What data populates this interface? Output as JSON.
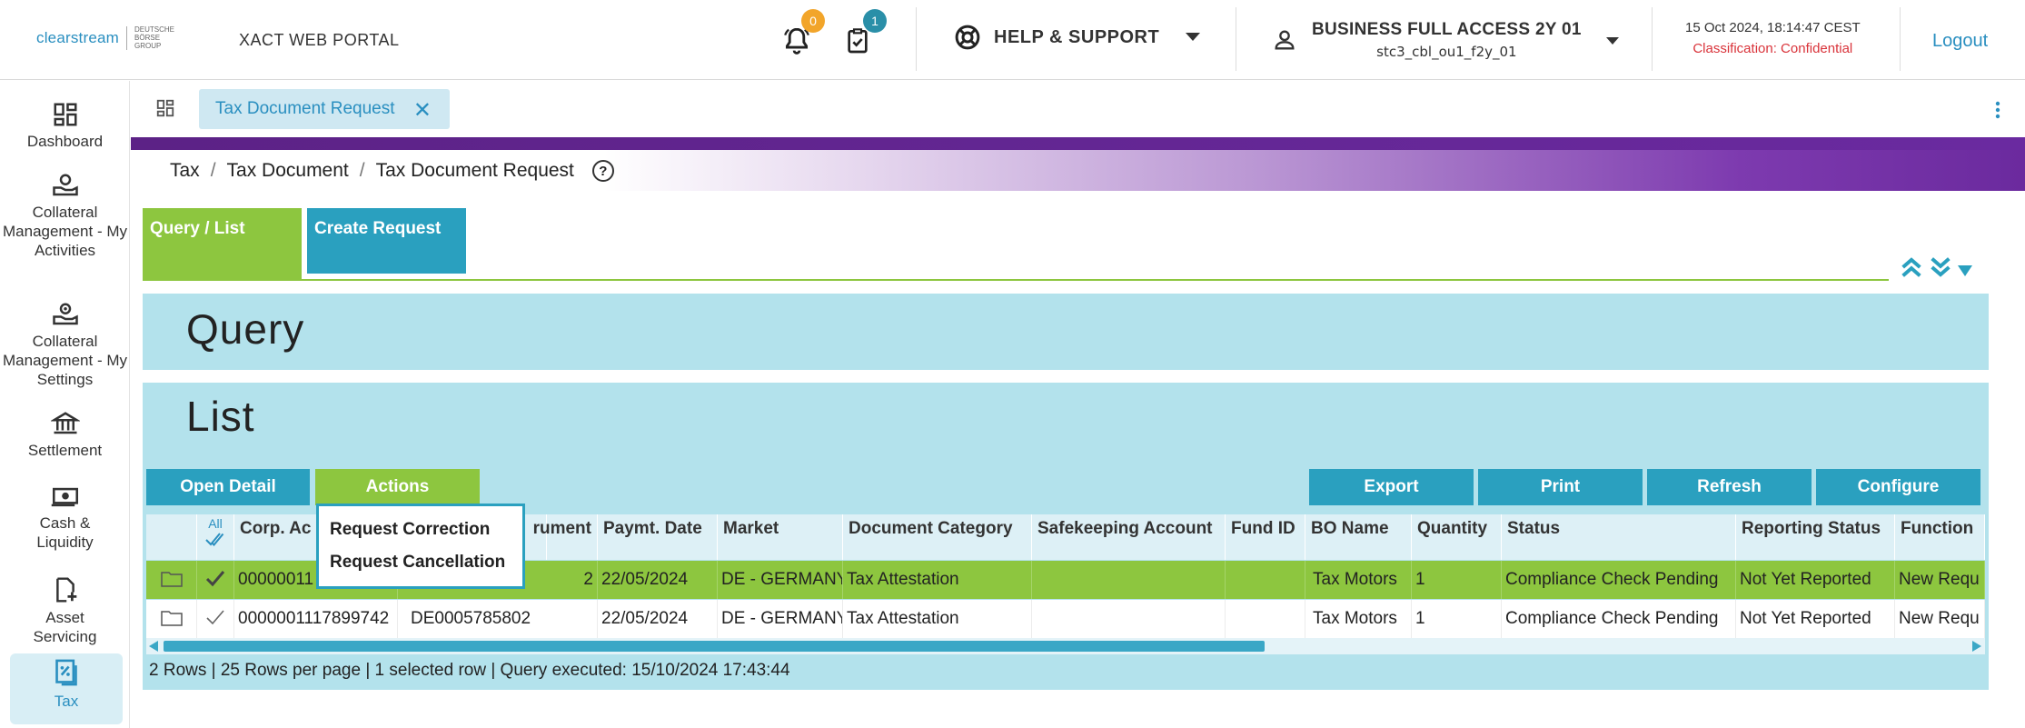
{
  "header": {
    "logo_text": "clearstream",
    "logo_sub": "DEUTSCHE BÖRSE GROUP",
    "portal_title": "XACT WEB PORTAL",
    "notifications_count": "0",
    "tasks_count": "1",
    "help_label": "HELP & SUPPORT",
    "user_name": "BUSINESS FULL ACCESS 2Y 01",
    "user_id": "stc3_cbl_ou1_f2y_01",
    "datetime": "15 Oct 2024, 18:14:47 CEST",
    "classification": "Classification: Confidential",
    "logout_label": "Logout"
  },
  "sidebar": {
    "items": [
      {
        "label": "Dashboard",
        "icon": "dashboard-icon"
      },
      {
        "label": "Collateral Management - My Activities",
        "icon": "hand-coin-icon"
      },
      {
        "label": "Collateral Management - My Settings",
        "icon": "hand-settings-icon"
      },
      {
        "label": "Settlement",
        "icon": "bank-icon"
      },
      {
        "label": "Cash & Liquidity",
        "icon": "cash-icon"
      },
      {
        "label": "Asset Servicing",
        "icon": "asset-icon"
      },
      {
        "label": "Tax",
        "icon": "tax-doc-icon"
      }
    ]
  },
  "tab": {
    "label": "Tax Document Request"
  },
  "breadcrumb": {
    "items": [
      "Tax",
      "Tax Document",
      "Tax Document Request"
    ]
  },
  "subtabs": {
    "query_list": "Query / List",
    "create_request": "Create Request"
  },
  "panels": {
    "query_title": "Query",
    "list_title": "List"
  },
  "buttons": {
    "open_detail": "Open Detail",
    "actions": "Actions",
    "export": "Export",
    "print": "Print",
    "refresh": "Refresh",
    "configure": "Configure"
  },
  "actions_menu": [
    "Request Correction",
    "Request Cancellation"
  ],
  "table": {
    "select_all": "All",
    "columns": [
      "Corp. Act",
      "Instrument",
      "Paymt. Date",
      "Market",
      "Document Category",
      "Safekeeping Account",
      "Fund ID",
      "BO Name",
      "Quantity",
      "Status",
      "Reporting Status",
      "Function"
    ],
    "header_visible": {
      "corp_act": "Corp. Ac",
      "instrument": "rument"
    },
    "rows": [
      {
        "corp_act": "00000011",
        "instrument": "2",
        "paymt_date": "22/05/2024",
        "market": "DE - GERMANY",
        "doc_category": "Tax Attestation",
        "safekeeping": "",
        "fund_id": "",
        "bo_name": "Tax  Motors",
        "quantity": "1",
        "status": "Compliance Check Pending",
        "reporting_status": "Not Yet Reported",
        "function": "New Requ"
      },
      {
        "corp_act": "0000001117899742",
        "instrument": "DE0005785802",
        "paymt_date": "22/05/2024",
        "market": "DE - GERMANY",
        "doc_category": "Tax Attestation",
        "safekeeping": "",
        "fund_id": "",
        "bo_name": "Tax  Motors",
        "quantity": "1",
        "status": "Compliance Check Pending",
        "reporting_status": "Not Yet Reported",
        "function": "New Requ"
      }
    ]
  },
  "status_bar": "2 Rows | 25 Rows per page | 1 selected row | Query executed: 15/10/2024 17:43:44",
  "colors": {
    "accent_blue": "#2aa0bf",
    "accent_green": "#8dc63f",
    "panel_bg": "#b3e2ec",
    "purple": "#6b2a9e",
    "classification_red": "#d9333a"
  }
}
